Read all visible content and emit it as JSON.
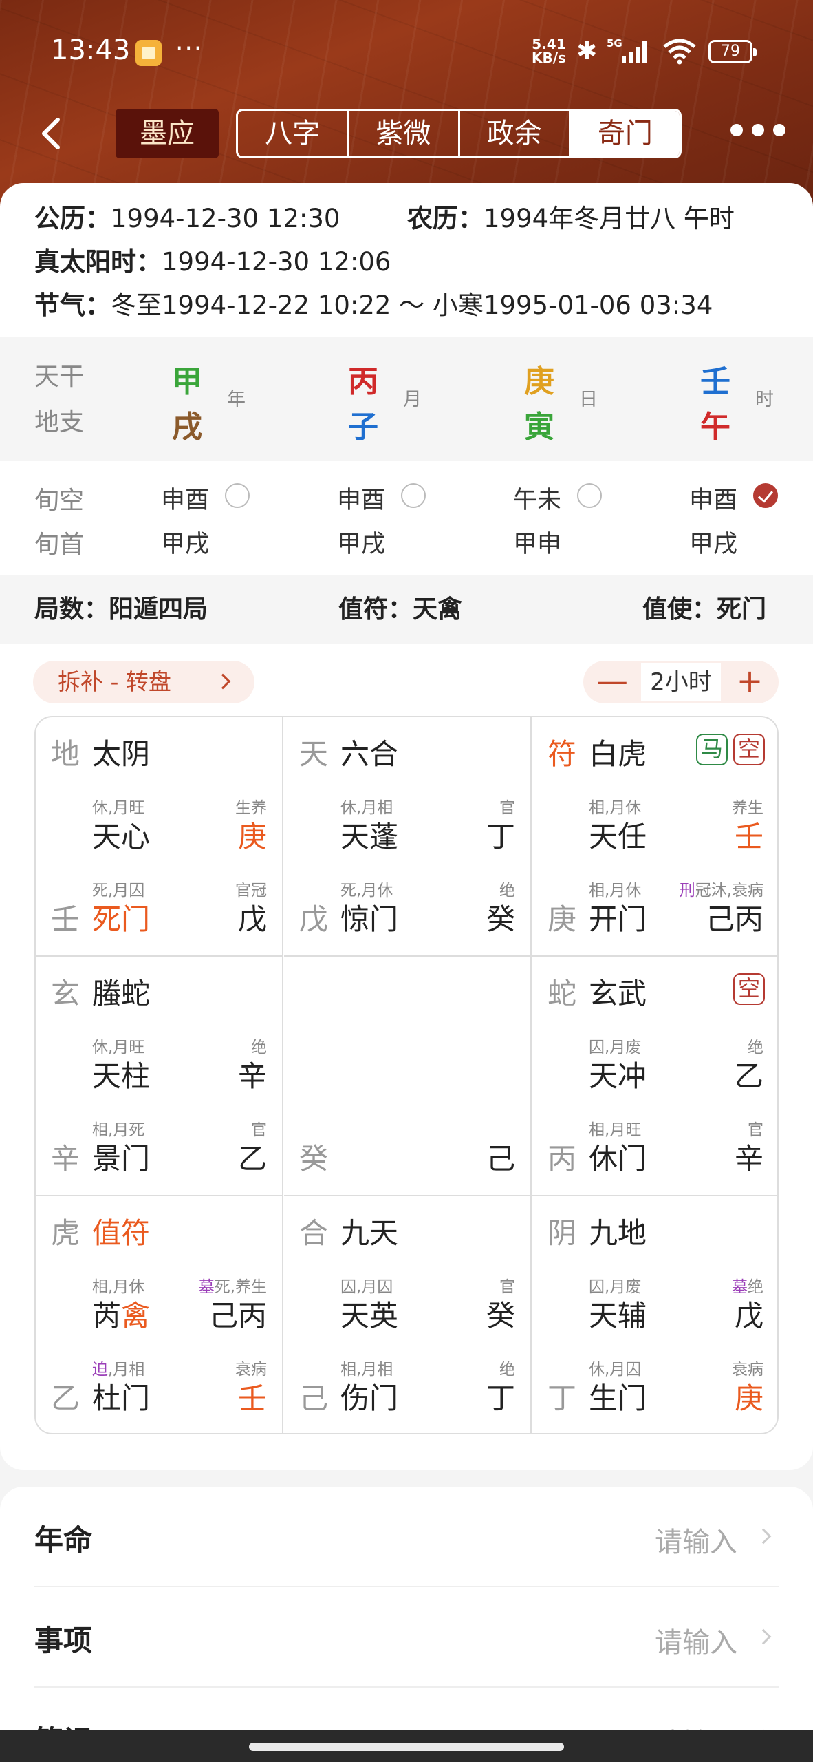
{
  "status": {
    "time": "13:43",
    "dots": "···",
    "net_speed": "5.41",
    "net_unit": "KB/s",
    "network": "5G",
    "battery": "79"
  },
  "nav": {
    "brand": "墨应",
    "tabs": [
      "八字",
      "紫微",
      "政余",
      "奇门"
    ],
    "active_tab": "奇门"
  },
  "info": {
    "gregorian_label": "公历：",
    "gregorian": "1994-12-30 12:30",
    "lunar_label": "农历：",
    "lunar": "1994年冬月廿八 午时",
    "solar_label": "真太阳时：",
    "solar": "1994-12-30 12:06",
    "jieqi_label": "节气：",
    "jieqi": "冬至1994-12-22 10:22 ～ 小寒1995-01-06 03:34"
  },
  "pillars": {
    "tiangan_label": "天干",
    "dizhi_label": "地支",
    "items": [
      {
        "gan": "甲",
        "zhi": "戌",
        "pos": "年",
        "gan_color": "#3aa53a",
        "zhi_color": "#8b5a2b"
      },
      {
        "gan": "丙",
        "zhi": "子",
        "pos": "月",
        "gan_color": "#d02a2a",
        "zhi_color": "#1f6fd0"
      },
      {
        "gan": "庚",
        "zhi": "寅",
        "pos": "日",
        "gan_color": "#e0a020",
        "zhi_color": "#3aa53a"
      },
      {
        "gan": "壬",
        "zhi": "午",
        "pos": "时",
        "gan_color": "#1f6fd0",
        "zhi_color": "#d02a2a"
      }
    ]
  },
  "xun": {
    "kong_label": "旬空",
    "shou_label": "旬首",
    "items": [
      {
        "kong": "申酉",
        "shou": "甲戌",
        "checked": false
      },
      {
        "kong": "申酉",
        "shou": "甲戌",
        "checked": false
      },
      {
        "kong": "午未",
        "shou": "甲申",
        "checked": false
      },
      {
        "kong": "申酉",
        "shou": "甲戌",
        "checked": true
      }
    ]
  },
  "ju": {
    "jushu_label": "局数：",
    "jushu": "阳遁四局",
    "zhifu_label": "值符：",
    "zhifu": "天禽",
    "zhishi_label": "值使：",
    "zhishi": "死门"
  },
  "toolbar": {
    "mode": "拆补 - 转盘",
    "minus": "—",
    "step": "2小时",
    "plus": "+"
  },
  "palaces": [
    {
      "god_mark": "地",
      "god": "太阴",
      "star_state": "休,月旺",
      "star": "天心",
      "star_stem": "庚",
      "star_phase": "生养",
      "gate_state": "死,月囚",
      "gate_stem_l": "壬",
      "gate": "死门",
      "gate_stem": "戊",
      "gate_phase": "官冠"
    },
    {
      "god_mark": "天",
      "god": "六合",
      "star_state": "休,月相",
      "star": "天蓬",
      "star_stem": "丁",
      "star_phase": "官",
      "gate_state": "死,月休",
      "gate_stem_l": "戊",
      "gate": "惊门",
      "gate_stem": "癸",
      "gate_phase": "绝"
    },
    {
      "god_mark": "符",
      "god": "白虎",
      "tag1": "马",
      "tag2": "空",
      "star_state": "相,月休",
      "star": "天任",
      "star_stem": "壬",
      "star_phase": "养生",
      "gate_state": "相,月休",
      "gate_stem_l": "庚",
      "gate": "开门",
      "gate_stem": "己丙",
      "gate_phase_mark": "刑",
      "gate_phase": "冠沐,衰病"
    },
    {
      "god_mark": "玄",
      "god": "螣蛇",
      "star_state": "休,月旺",
      "star": "天柱",
      "star_stem": "辛",
      "star_phase": "绝",
      "gate_state": "相,月死",
      "gate_stem_l": "辛",
      "gate": "景门",
      "gate_stem": "乙",
      "gate_phase": "官"
    },
    {
      "center_l": "癸",
      "center_r": "己"
    },
    {
      "god_mark": "蛇",
      "god": "玄武",
      "tag2": "空",
      "star_state": "囚,月废",
      "star": "天冲",
      "star_stem": "乙",
      "star_phase": "绝",
      "gate_state": "相,月旺",
      "gate_stem_l": "丙",
      "gate": "休门",
      "gate_stem": "辛",
      "gate_phase": "官"
    },
    {
      "god_mark": "虎",
      "god": "值符",
      "star_state": "相,月休",
      "star_a": "芮",
      "star_b": "禽",
      "star_stem": "己丙",
      "star_phase_mark": "墓",
      "star_phase": "死,养生",
      "gate_state_mark": "迫",
      "gate_state": ",月相",
      "gate_stem_l": "乙",
      "gate": "杜门",
      "gate_stem": "壬",
      "gate_phase": "衰病"
    },
    {
      "god_mark": "合",
      "god": "九天",
      "star_state": "囚,月囚",
      "star": "天英",
      "star_stem": "癸",
      "star_phase": "官",
      "gate_state": "相,月相",
      "gate_stem_l": "己",
      "gate": "伤门",
      "gate_stem": "丁",
      "gate_phase": "绝"
    },
    {
      "god_mark": "阴",
      "god": "九地",
      "star_state": "囚,月废",
      "star": "天辅",
      "star_stem": "戊",
      "star_phase_mark": "墓",
      "star_phase": "绝",
      "gate_state": "休,月囚",
      "gate_stem_l": "丁",
      "gate": "生门",
      "gate_stem": "庚",
      "gate_phase": "衰病"
    }
  ],
  "form": {
    "rows": [
      {
        "label": "年命",
        "placeholder": "请输入"
      },
      {
        "label": "事项",
        "placeholder": "请输入"
      },
      {
        "label": "笔记",
        "placeholder": "请输入"
      }
    ]
  },
  "colors": {
    "accent": "#8a2a14",
    "orange": "#ea5a1f",
    "purple": "#9b3fb8"
  }
}
